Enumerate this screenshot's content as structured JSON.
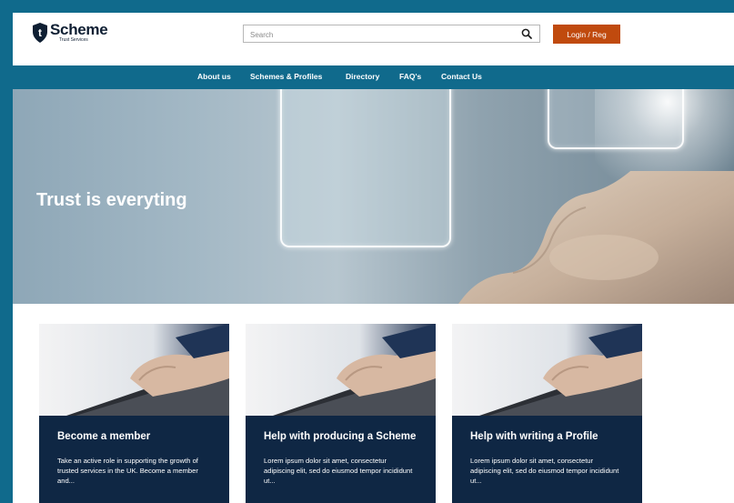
{
  "header": {
    "logo": {
      "name": "Scheme",
      "subtitle": "Trust Services",
      "mark_letter": "t"
    },
    "search": {
      "placeholder": "Search",
      "icon": "search-icon"
    },
    "login_label": "Login / Reg"
  },
  "nav": {
    "items": [
      {
        "label": "About us"
      },
      {
        "label": "Schemes & Profiles"
      },
      {
        "label": "Directory"
      },
      {
        "label": "FAQ's"
      },
      {
        "label": "Contact Us"
      }
    ]
  },
  "hero": {
    "title": "Trust is everyting"
  },
  "cards": [
    {
      "title": "Become a member",
      "text": "Take an active role in supporting the growth of trusted services in the UK. Become a member and..."
    },
    {
      "title": "Help with producing a Scheme",
      "text": "Lorem ipsum dolor sit amet, consectetur adipiscing elit, sed do eiusmod tempor incididunt ut..."
    },
    {
      "title": "Help with writing a Profile",
      "text": "Lorem ipsum dolor sit amet, consectetur adipiscing elit, sed do eiusmod tempor incididunt ut..."
    }
  ],
  "colors": {
    "frame": "#106a8c",
    "nav_bg": "#106a8c",
    "login_button": "#c04a0e",
    "card_body": "#0f2744",
    "logo_text": "#0f1f33"
  }
}
